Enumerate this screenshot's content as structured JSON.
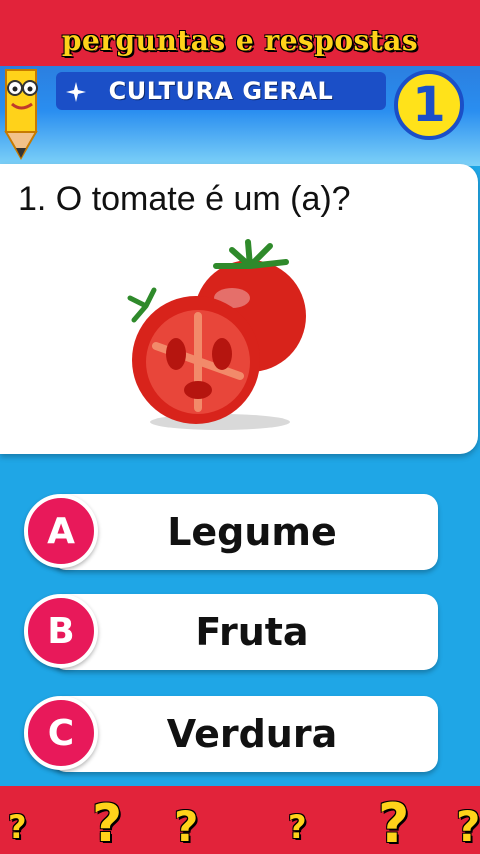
{
  "channel_title": "perguntas e respostas",
  "category": "CULTURA GERAL",
  "level": "1",
  "question": "1. O tomate é um (a)?",
  "question_image_icon": "tomato-image",
  "answers": [
    {
      "letter": "A",
      "label": "Legume"
    },
    {
      "letter": "B",
      "label": "Fruta"
    },
    {
      "letter": "C",
      "label": "Verdura"
    }
  ],
  "decor_symbol": "?",
  "colors": {
    "top_bar": "#e2233a",
    "category_banner": "#1b4fc7",
    "badge": "#ffe21a",
    "answer_letter": "#e8195a",
    "question_mark": "#ffd21a"
  }
}
